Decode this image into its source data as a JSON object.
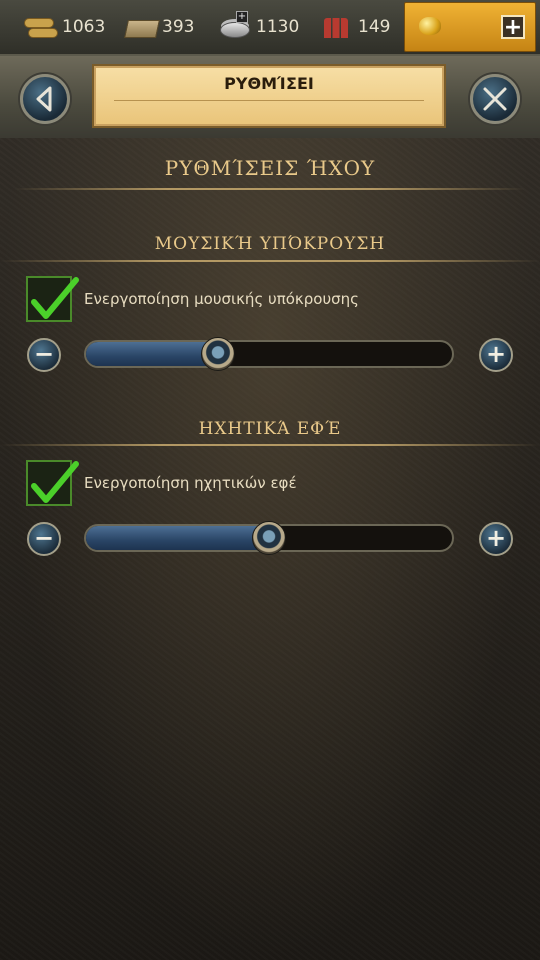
{
  "resources": [
    {
      "icon": "wood-icon",
      "value": "1063"
    },
    {
      "icon": "stone-icon",
      "value": "393"
    },
    {
      "icon": "silver-icon",
      "value": "1130"
    },
    {
      "icon": "troops-icon",
      "value": "149"
    }
  ],
  "gold_button": {
    "icon": "gold-nugget-icon",
    "plus": "+"
  },
  "header": {
    "title": "ΡΥΘΜΊΣΕΙ",
    "back_icon": "back-arrow-icon",
    "close_icon": "close-x-icon"
  },
  "page": {
    "heading": "ΡΥΘΜΊΣΕΙΣ ΉΧΟΥ"
  },
  "music": {
    "heading": "ΜΟΥΣΙΚΉ ΥΠΌΚΡΟΥΣΗ",
    "checkbox_label": "Ενεργοποίηση μουσικής υπόκρουσης",
    "checked": true,
    "volume_fraction": 0.36,
    "minus": "−",
    "plus": "+"
  },
  "effects": {
    "heading": "ΗΧΗΤΙΚΆ ΕΦΈ",
    "checkbox_label": "Ενεργοποίηση ηχητικών εφέ",
    "checked": true,
    "volume_fraction": 0.5,
    "minus": "−",
    "plus": "+"
  },
  "colors": {
    "heading_gold": "#e9c98a",
    "gold_button": "#f0b234",
    "checkmark_green": "#4bd02a",
    "slider_blue": "#2a4566"
  }
}
